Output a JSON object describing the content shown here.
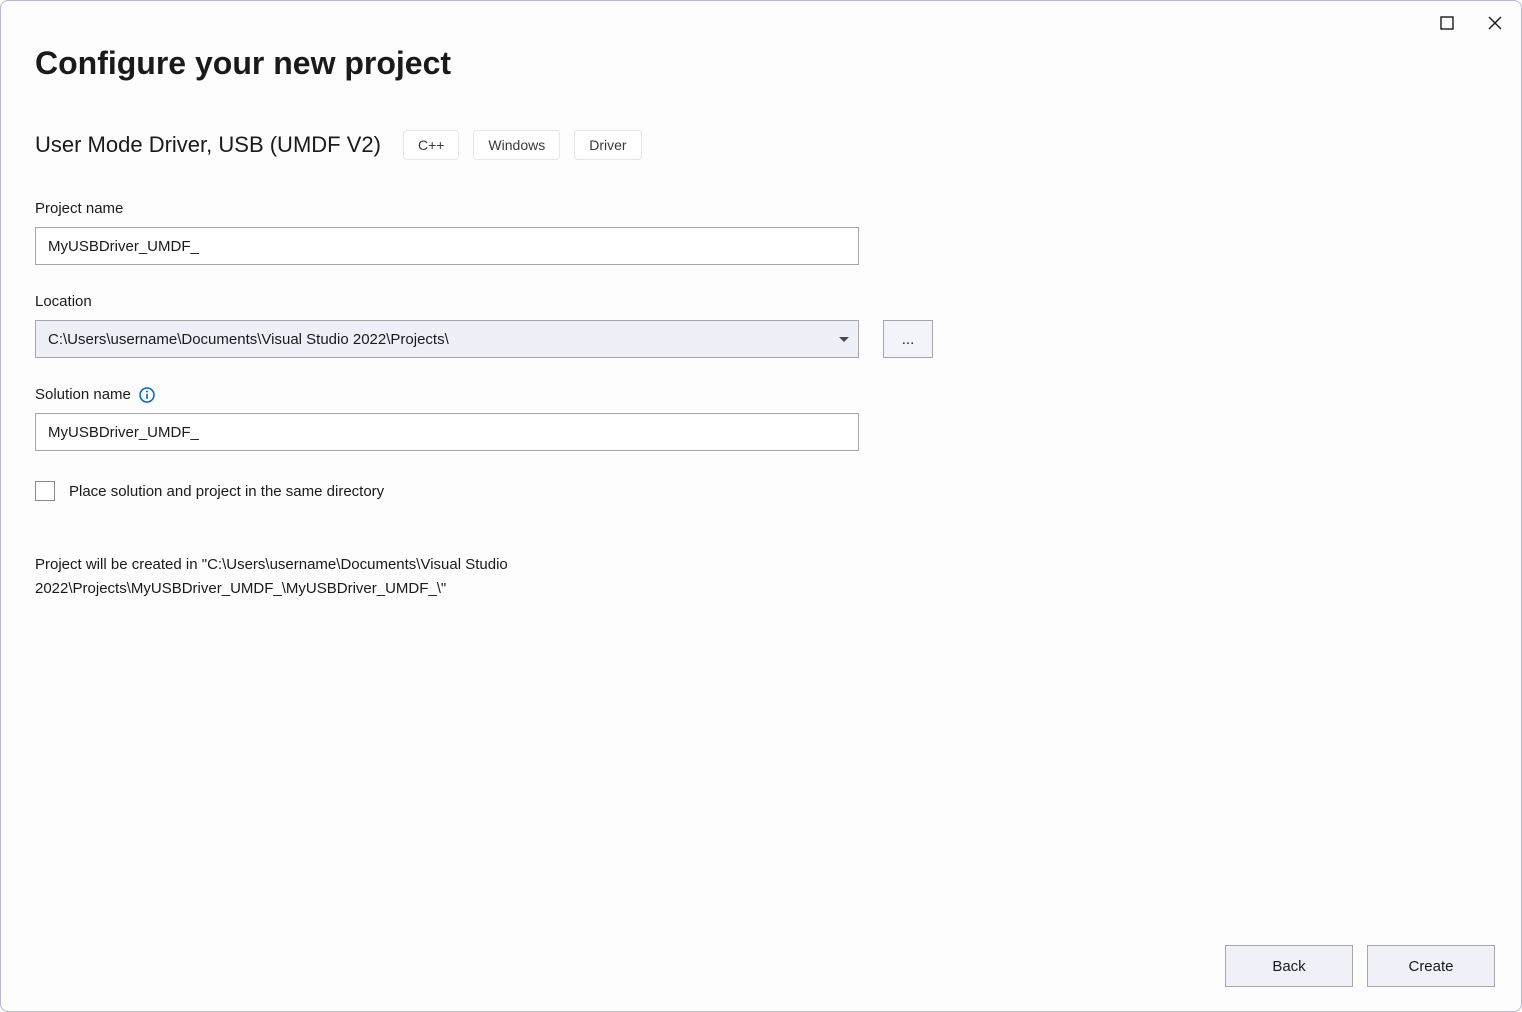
{
  "header": {
    "title": "Configure your new project"
  },
  "template": {
    "name": "User Mode Driver, USB (UMDF V2)",
    "tags": [
      "C++",
      "Windows",
      "Driver"
    ]
  },
  "fields": {
    "project_name": {
      "label": "Project name",
      "value": "MyUSBDriver_UMDF_"
    },
    "location": {
      "label": "Location",
      "value": "C:\\Users\\username\\Documents\\Visual Studio 2022\\Projects\\",
      "browse_label": "..."
    },
    "solution_name": {
      "label": "Solution name",
      "value": "MyUSBDriver_UMDF_"
    }
  },
  "checkbox": {
    "label": "Place solution and project in the same directory",
    "checked": false
  },
  "path_preview": "Project will be created in \"C:\\Users\\username\\Documents\\Visual Studio 2022\\Projects\\MyUSBDriver_UMDF_\\MyUSBDriver_UMDF_\\\"",
  "footer": {
    "back_label": "Back",
    "create_label": "Create"
  }
}
